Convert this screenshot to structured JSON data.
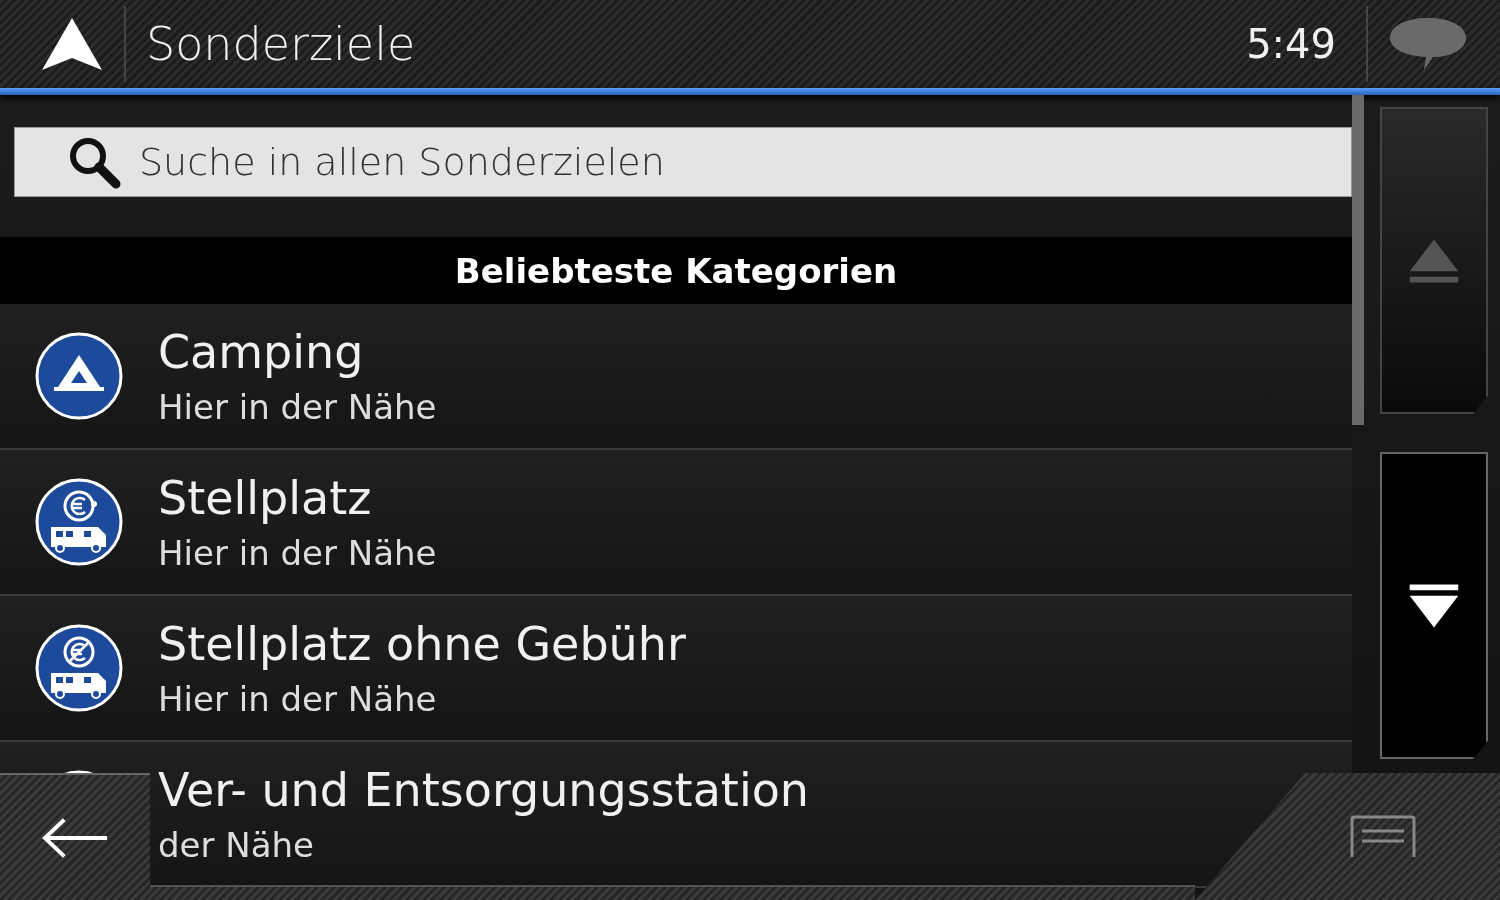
{
  "header": {
    "title": "Sonderziele",
    "time": "5:49"
  },
  "search": {
    "placeholder": "Suche in allen Sonderzielen"
  },
  "section": {
    "title": "Beliebteste Kategorien"
  },
  "rows": [
    {
      "kind": "camping",
      "title": "Camping",
      "subtitle": "Hier in der Nähe"
    },
    {
      "kind": "paid-parking",
      "title": "Stellplatz",
      "subtitle": "Hier in der Nähe"
    },
    {
      "kind": "free-parking",
      "title": "Stellplatz ohne Gebühr",
      "subtitle": "Hier in der Nähe"
    },
    {
      "kind": "service",
      "title": "Ver- und Entsorgungsstation",
      "subtitle": "der Nähe"
    }
  ],
  "scroll_buttons": [
    {
      "kind": "up",
      "disabled": true
    },
    {
      "kind": "down",
      "disabled": false
    }
  ]
}
